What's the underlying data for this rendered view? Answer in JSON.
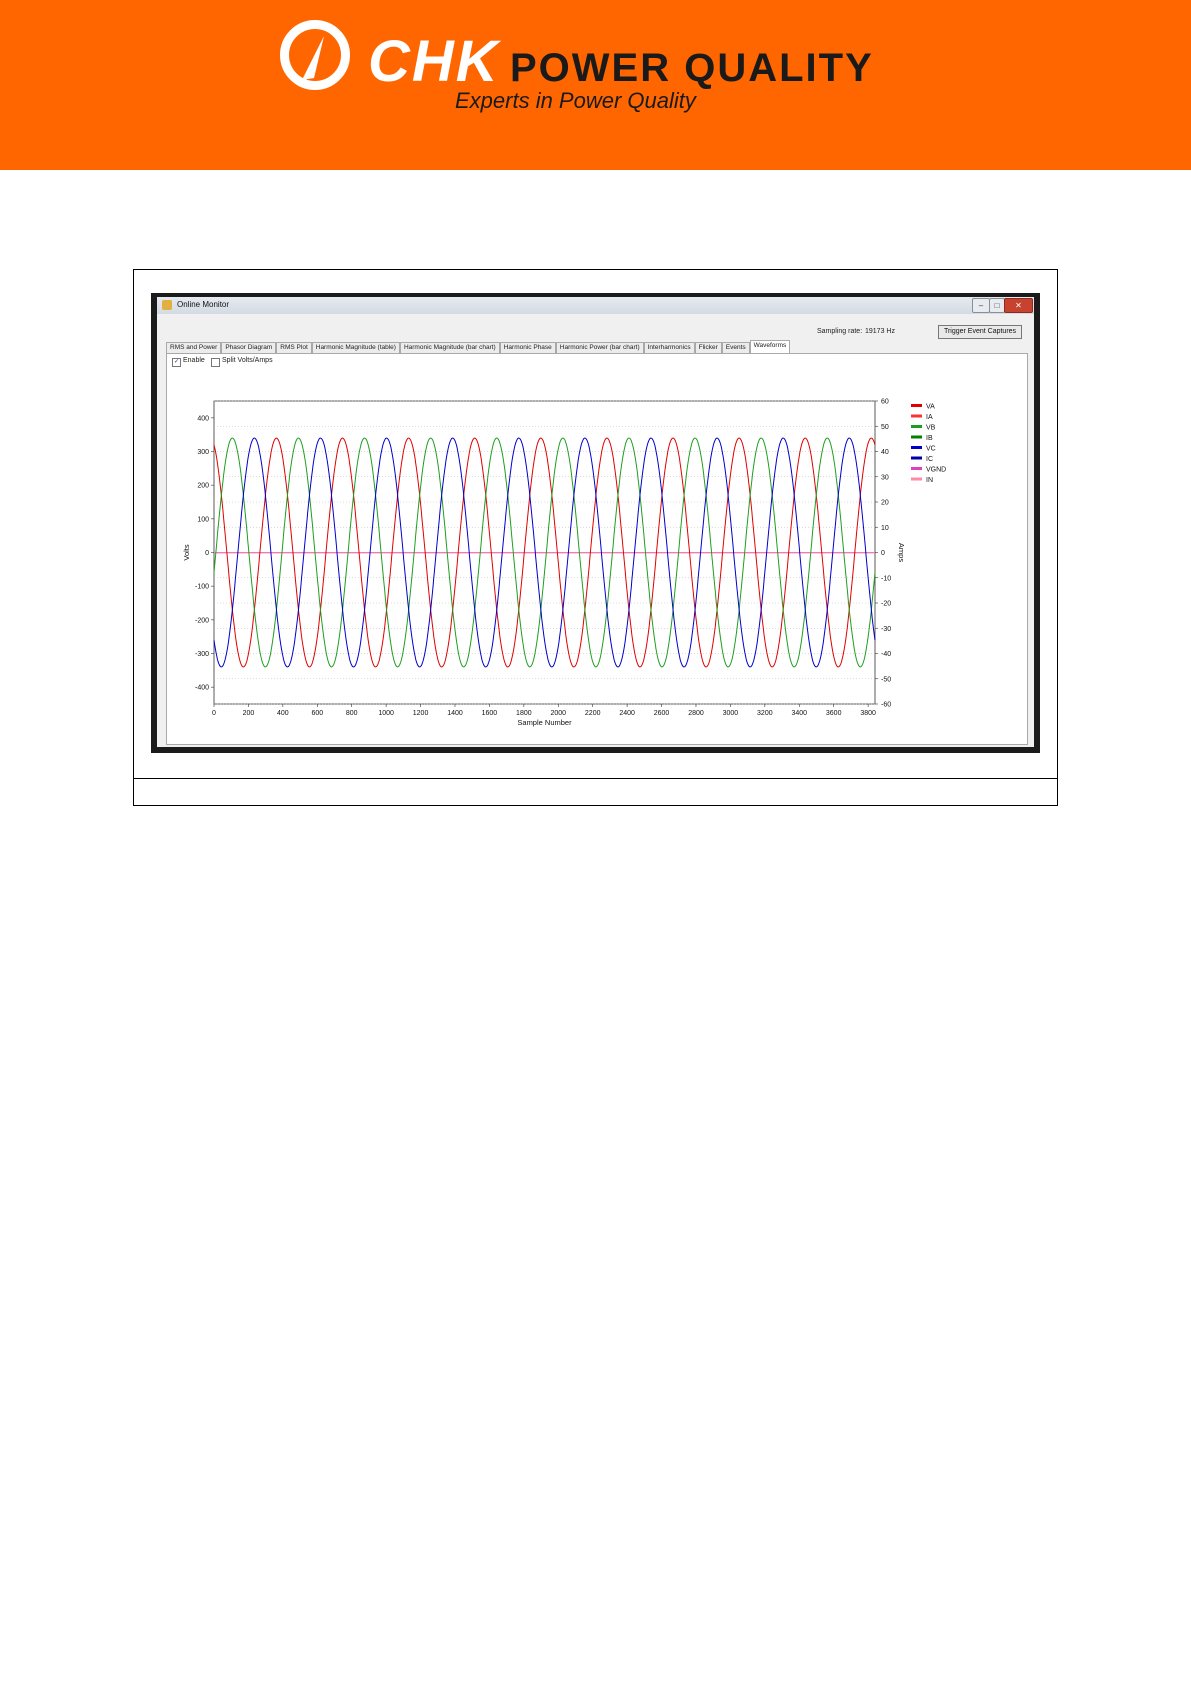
{
  "header": {
    "logo_chk": "CHK",
    "logo_pq": "POWER QUALITY",
    "tagline": "Experts in Power Quality"
  },
  "window": {
    "title": "Online Monitor",
    "sampling_label": "Sampling rate:",
    "sampling_value": "19173 Hz",
    "trigger_button": "Trigger Event Captures",
    "tabs": [
      "RMS and Power",
      "Phasor Diagram",
      "RMS Plot",
      "Harmonic Magnitude (table)",
      "Harmonic Magnitude (bar chart)",
      "Harmonic Phase",
      "Harmonic Power (bar chart)",
      "Interharmonics",
      "Flicker",
      "Events",
      "Waveforms"
    ],
    "active_tab": "Waveforms",
    "enable_label": "Enable",
    "enable_checked": true,
    "split_label": "Split Volts/Amps",
    "split_checked": false
  },
  "chart_data": {
    "type": "line",
    "xlabel": "Sample Number",
    "ylabel": "Volts",
    "y2label": "Amps",
    "xlim": [
      0,
      3840
    ],
    "ylim": [
      -450,
      450
    ],
    "y2lim": [
      -60,
      60
    ],
    "xticks": [
      0,
      200,
      400,
      600,
      800,
      1000,
      1200,
      1400,
      1600,
      1800,
      2000,
      2200,
      2400,
      2600,
      2800,
      3000,
      3200,
      3400,
      3600,
      3800
    ],
    "yticks": [
      400,
      300,
      200,
      100,
      0,
      -100,
      -200,
      -300,
      -400
    ],
    "y2ticks": [
      60,
      50,
      40,
      30,
      20,
      10,
      0,
      -10,
      -20,
      -30,
      -40,
      -50,
      -60
    ],
    "grid": true,
    "legend_position": "right",
    "waveform_period_samples": 384,
    "amplitude_volts": 340,
    "series": [
      {
        "name": "VA",
        "color": "#e00000",
        "phase_deg": 110
      },
      {
        "name": "IA",
        "color": "#ff3030",
        "phase_deg": 110
      },
      {
        "name": "VB",
        "color": "#1e9e1e",
        "phase_deg": -10
      },
      {
        "name": "IB",
        "color": "#008000",
        "phase_deg": -10
      },
      {
        "name": "VC",
        "color": "#0000cc",
        "phase_deg": 230
      },
      {
        "name": "IC",
        "color": "#0000aa",
        "phase_deg": 230
      },
      {
        "name": "VGND",
        "color": "#e040c0",
        "phase_deg": null
      },
      {
        "name": "IN",
        "color": "#ff8aa8",
        "phase_deg": null
      }
    ]
  }
}
